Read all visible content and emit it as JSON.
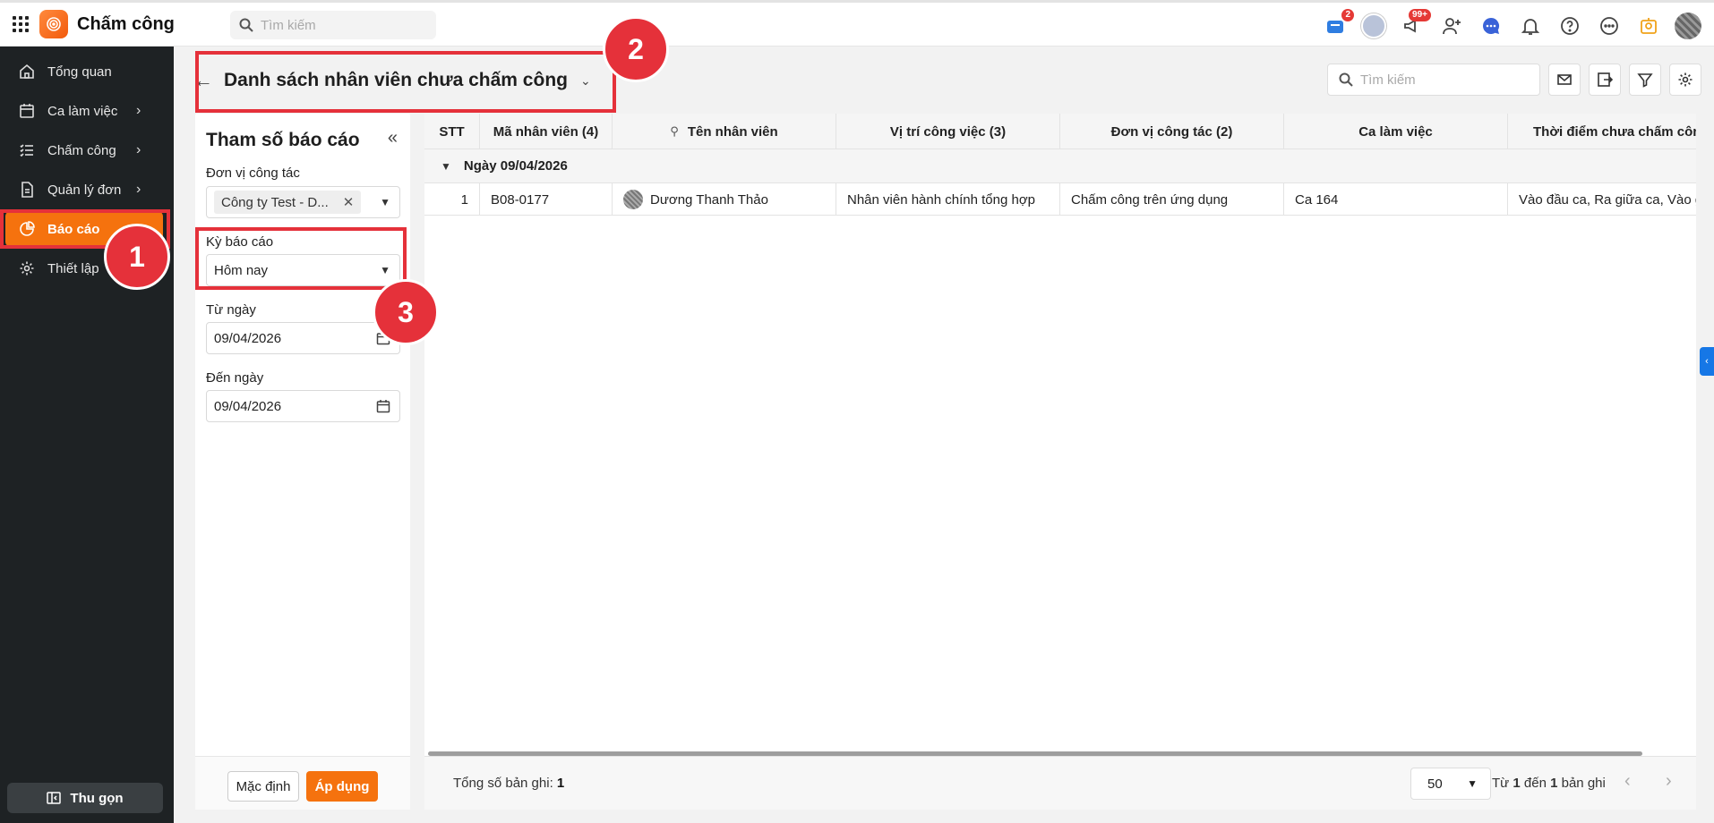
{
  "app": {
    "name": "Chấm công",
    "search_placeholder": "Tìm kiếm",
    "badges": {
      "cart": "2",
      "megaphone": "99+"
    }
  },
  "sidebar": {
    "items": [
      {
        "label": "Tổng quan",
        "icon": "home-icon",
        "has_chevron": false,
        "active": false
      },
      {
        "label": "Ca làm việc",
        "icon": "calendar-icon",
        "has_chevron": true,
        "active": false
      },
      {
        "label": "Chấm công",
        "icon": "checklist-icon",
        "has_chevron": true,
        "active": false
      },
      {
        "label": "Quản lý đơn",
        "icon": "document-icon",
        "has_chevron": true,
        "active": false
      },
      {
        "label": "Báo cáo",
        "icon": "pie-chart-icon",
        "has_chevron": false,
        "active": true
      },
      {
        "label": "Thiết lập",
        "icon": "gear-icon",
        "has_chevron": false,
        "active": false
      }
    ],
    "collapse_label": "Thu gọn"
  },
  "page": {
    "title": "Danh sách nhân viên chưa chấm công",
    "search_placeholder": "Tìm kiếm"
  },
  "params": {
    "title": "Tham số báo cáo",
    "unit_label": "Đơn vị công tác",
    "unit_value": "Công ty Test - D...",
    "period_label": "Kỳ báo cáo",
    "period_value": "Hôm nay",
    "from_label": "Từ ngày",
    "from_value": "09/04/2026",
    "to_label": "Đến ngày",
    "to_value": "09/04/2026",
    "default_button": "Mặc định",
    "apply_button": "Áp dụng"
  },
  "table": {
    "columns": [
      "STT",
      "Mã nhân viên (4)",
      "Tên nhân viên",
      "Vị trí công việc (3)",
      "Đơn vị công tác (2)",
      "Ca làm việc",
      "Thời điểm chưa chấm công"
    ],
    "group_label": "Ngày 09/04/2026",
    "rows": [
      {
        "stt": "1",
        "code": "B08-0177",
        "name": "Dương Thanh Thảo",
        "position": "Nhân viên hành chính tổng hợp",
        "unit": "Chấm công trên ứng dụng",
        "shift": "Ca 164",
        "missing": "Vào đầu ca, Ra giữa ca, Vào giữa ca"
      }
    ],
    "total_label": "Tổng số bản ghi:",
    "total_value": "1",
    "page_size": "50",
    "range_prefix": "Từ",
    "range_from": "1",
    "range_mid": "đến",
    "range_to": "1",
    "range_suffix": "bản ghi"
  },
  "annotations": [
    "1",
    "2",
    "3"
  ],
  "colors": {
    "accent": "#f5720e",
    "annotation": "#e5313a",
    "sidebar_bg": "#1e2224"
  }
}
